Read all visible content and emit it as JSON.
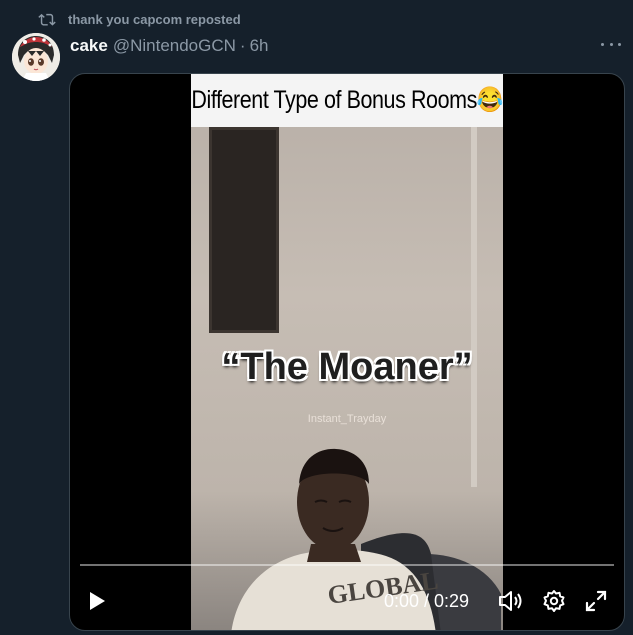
{
  "repost": {
    "text": "thank you capcom reposted",
    "icon": "repost-icon"
  },
  "author": {
    "name": "cake",
    "handle": "@NintendoGCN",
    "separator": "·",
    "time": "6h",
    "avatar_icon": "anime-avatar"
  },
  "more_icon": "more-dots-icon",
  "video": {
    "caption": "Different Type of Bonus Rooms😂",
    "overlay_title": "“The Moaner”",
    "watermark": "Instant_Trayday",
    "shirt_text": "GLOBAL",
    "progress": 0.0,
    "time": "0:00 / 0:29",
    "controls": [
      "play-icon",
      "volume-icon",
      "settings-icon",
      "fullscreen-icon"
    ]
  },
  "colors": {
    "background": "#15202b",
    "secondary_text": "#8b98a5",
    "border": "#38444d"
  }
}
